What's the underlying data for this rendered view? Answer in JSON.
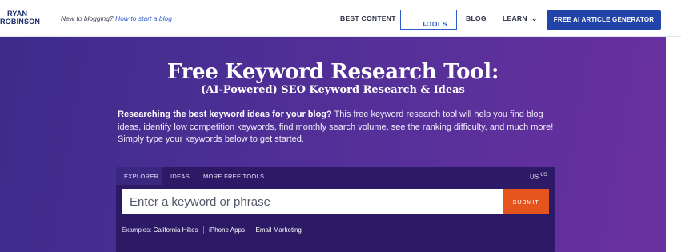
{
  "header": {
    "logo_line1": "RYAN",
    "logo_line2": "ROBINSON",
    "tagline_text": "New to blogging?",
    "tagline_link": "How to start a blog",
    "nav": {
      "best_content": "BEST CONTENT",
      "tools": "TOOLS",
      "blog": "BLOG",
      "learn": "LEARN",
      "cta": "FREE AI ARTICLE GENERATOR"
    }
  },
  "hero": {
    "title": "Free Keyword Research Tool:",
    "subtitle": "(AI-Powered) SEO Keyword Research & Ideas",
    "description_bold": "Researching the best keyword ideas for your blog?",
    "description_rest": " This free keyword research tool will help you find blog ideas, identify low competition keywords, find monthly search volume, see the ranking difficulty, and much more! Simply type your keywords below to get started."
  },
  "tool": {
    "tabs": [
      "EXPLORER",
      "IDEAS",
      "MORE FREE TOOLS"
    ],
    "active_tab": "EXPLORER",
    "locale_main": "US",
    "locale_sup": "US",
    "search_placeholder": "Enter a keyword or phrase",
    "search_value": "",
    "submit_label": "SUBMIT",
    "examples_label": "Examples:",
    "examples": [
      "California Hikes",
      "iPhone Apps",
      "Email Marketing"
    ]
  },
  "colors": {
    "brand_blue": "#2244a8",
    "hero_gradient_start": "#3d2c8a",
    "hero_gradient_end": "#6a309f",
    "submit_orange": "#e5541d"
  }
}
